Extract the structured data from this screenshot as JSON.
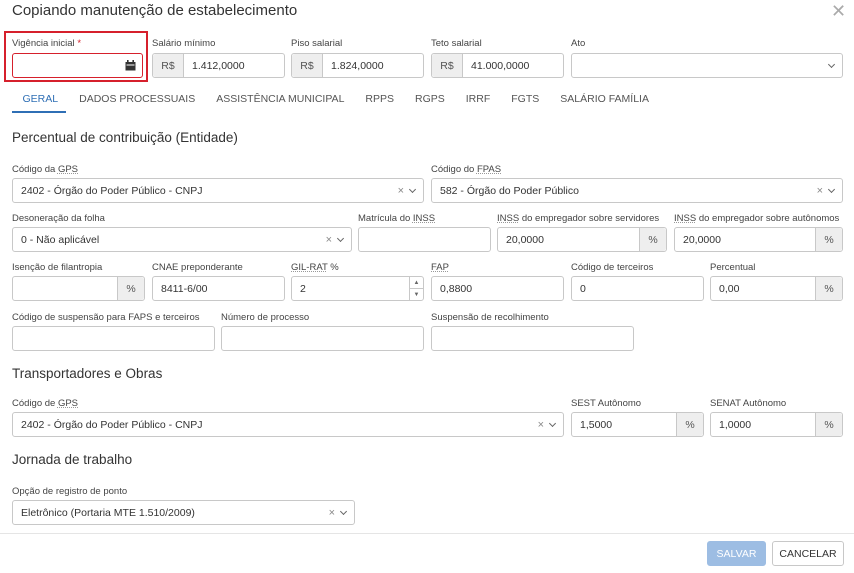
{
  "dialog": {
    "title": "Copiando manutenção de estabelecimento"
  },
  "header_fields": {
    "vigencia": {
      "label": "Vigência inicial",
      "required_mark": "*",
      "value": ""
    },
    "salario_minimo": {
      "label": "Salário mínimo",
      "prefix": "R$",
      "value": "1.412,0000"
    },
    "piso_salarial": {
      "label": "Piso salarial",
      "prefix": "R$",
      "value": "1.824,0000"
    },
    "teto_salarial": {
      "label": "Teto salarial",
      "prefix": "R$",
      "value": "41.000,0000"
    },
    "ato": {
      "label": "Ato",
      "value": ""
    }
  },
  "tabs": [
    {
      "label": "GERAL"
    },
    {
      "label": "DADOS PROCESSUAIS"
    },
    {
      "label": "ASSISTÊNCIA MUNICIPAL"
    },
    {
      "label": "RPPS"
    },
    {
      "label": "RGPS"
    },
    {
      "label": "IRRF"
    },
    {
      "label": "FGTS"
    },
    {
      "label": "SALÁRIO FAMÍLIA"
    }
  ],
  "percentual": {
    "title": "Percentual de contribuição (Entidade)",
    "codigo_gps": {
      "label_pre": "Código da ",
      "label_u": "GPS",
      "value": "2402 - Órgão do Poder Público - CNPJ"
    },
    "codigo_fpas": {
      "label_pre": "Código do ",
      "label_u": "FPAS",
      "value": "582 - Órgão do Poder Público"
    },
    "desoneracao": {
      "label": "Desoneração da folha",
      "value": "0 - Não aplicável"
    },
    "matricula_inss": {
      "label_pre": "Matrícula do ",
      "label_u": "INSS",
      "value": ""
    },
    "inss_servidores": {
      "label_u": "INSS",
      "label_post": " do empregador sobre servidores",
      "value": "20,0000",
      "suffix": "%"
    },
    "inss_autonomos": {
      "label_u": "INSS",
      "label_post": " do empregador sobre autônomos",
      "value": "20,0000",
      "suffix": "%"
    },
    "isencao": {
      "label": "Isenção de filantropia",
      "value": "",
      "suffix": "%"
    },
    "cnae": {
      "label": "CNAE preponderante",
      "value": "8411-6/00"
    },
    "gilrat": {
      "label_u": "GIL-RAT",
      "label_post": " %",
      "value": "2"
    },
    "fap": {
      "label_u": "FAP",
      "value": "0,8800"
    },
    "codigo_terceiros": {
      "label": "Código de terceiros",
      "value": "0"
    },
    "percentual": {
      "label": "Percentual",
      "value": "0,00",
      "suffix": "%"
    },
    "codigo_suspensao": {
      "label": "Código de suspensão para FAPS e terceiros",
      "value": ""
    },
    "numero_processo": {
      "label": "Número de processo",
      "value": ""
    },
    "suspensao_recolhimento": {
      "label": "Suspensão de recolhimento",
      "value": ""
    }
  },
  "transportadores": {
    "title": "Transportadores e Obras",
    "codigo_gps": {
      "label_pre": "Código de ",
      "label_u": "GPS",
      "value": "2402 - Órgão do Poder Público - CNPJ"
    },
    "sest": {
      "label": "SEST Autônomo",
      "value": "1,5000",
      "suffix": "%"
    },
    "senat": {
      "label": "SENAT Autônomo",
      "value": "1,0000",
      "suffix": "%"
    }
  },
  "jornada": {
    "title": "Jornada de trabalho",
    "opcao_ponto": {
      "label": "Opção de registro de ponto",
      "value": "Eletrônico (Portaria MTE 1.510/2009)"
    }
  },
  "footer": {
    "save_label": "SALVAR",
    "cancel_label": "CANCELAR"
  },
  "icons": {
    "close": "close-icon",
    "calendar": "calendar-icon",
    "clear": "clear-icon",
    "chevron": "chevron-down-icon"
  },
  "colors": {
    "accent": "#2f6fb5",
    "highlight": "#d6202c",
    "save_disabled": "#9dbde3"
  }
}
